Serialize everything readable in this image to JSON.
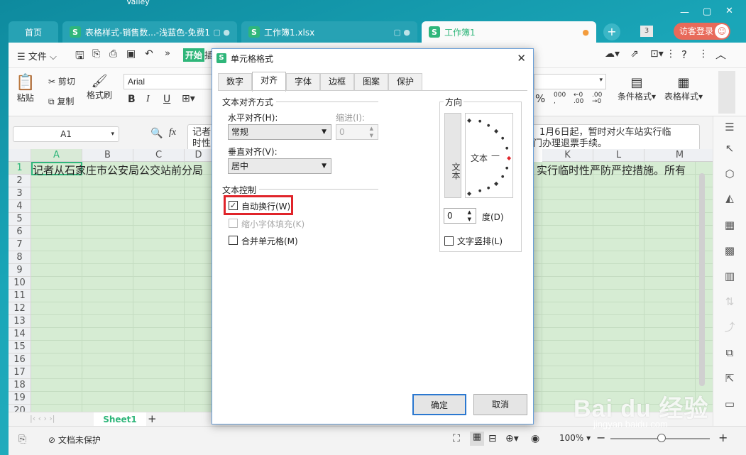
{
  "tabs": [
    {
      "label": "首页",
      "active": false
    },
    {
      "label": "表格样式-销售数...-浅蓝色-免费1",
      "active": false
    },
    {
      "label": "工作簿1.xlsx",
      "active": false
    },
    {
      "label": "工作簿1",
      "active": true
    }
  ],
  "tab_add": "+",
  "window_count": "3",
  "login_label": "访客登录",
  "menu": {
    "file": "文件",
    "start": "开始",
    "insert_partial": "插"
  },
  "ribbon": {
    "paste": "粘贴",
    "cut": "剪切",
    "copy": "复制",
    "format_painter": "格式刷",
    "font": "Arial",
    "bold": "B",
    "italic": "I",
    "underline": "U",
    "conditional_format": "条件格式",
    "table_style": "表格样式",
    "percent": "%"
  },
  "formula": {
    "cell_ref": "A1",
    "fx": "fx",
    "content_line1": "记者",
    "content_line2": "时性",
    "content_right1": "，1月6日起，暂时对火车站实行临",
    "content_right2": "门办理退票手续。"
  },
  "columns": [
    "A",
    "B",
    "C",
    "D",
    "K",
    "L",
    "M"
  ],
  "rows": [
    "1",
    "2",
    "3",
    "4",
    "5",
    "6",
    "7",
    "8",
    "9",
    "10",
    "11",
    "12",
    "13",
    "14",
    "15",
    "16",
    "17",
    "18",
    "19",
    "20"
  ],
  "cell_a1_left": "记者从石家庄市公安局公交站前分局",
  "cell_a1_right": "实行临时性严防严控措施。所有",
  "sheet_tab": "Sheet1",
  "status": {
    "protect": "文档未保护",
    "zoom": "100%"
  },
  "dialog": {
    "title": "单元格格式",
    "tabs": [
      "数字",
      "对齐",
      "字体",
      "边框",
      "图案",
      "保护"
    ],
    "active_tab": "对齐",
    "text_align_group": "文本对齐方式",
    "horizontal_label": "水平对齐(H):",
    "horizontal_value": "常规",
    "indent_label": "缩进(I):",
    "indent_value": "0",
    "vertical_label": "垂直对齐(V):",
    "vertical_value": "居中",
    "text_control_group": "文本控制",
    "wrap_text": "自动换行(W)",
    "wrap_checked": true,
    "shrink": "缩小字体填充(K)",
    "merge": "合并单元格(M)",
    "direction_group": "方向",
    "vertical_text": "文本",
    "orient_text": "文本",
    "degree_value": "0",
    "degree_label": "度(D)",
    "vertical_arrange": "文字竖排(L)",
    "ok": "确定",
    "cancel": "取消"
  },
  "watermark": "Bai du 经验",
  "watermark_url": "jingyan.baidu.com",
  "colors": {
    "accent": "#2fb67a",
    "highlight": "#e0242a",
    "cell_bg": "#d6ecd3",
    "dialog_border": "#6a9fd8"
  }
}
